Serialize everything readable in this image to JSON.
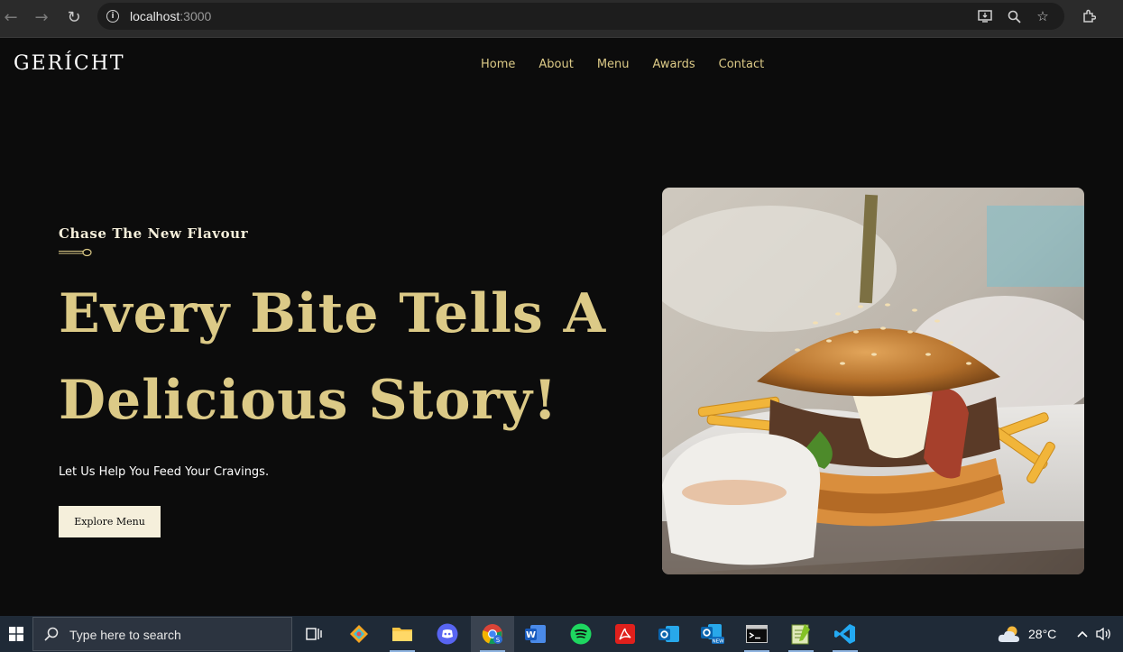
{
  "browser": {
    "url_host": "localhost",
    "url_port": ":3000"
  },
  "site": {
    "logo": "GERÍCHT",
    "nav": [
      "Home",
      "About",
      "Menu",
      "Awards",
      "Contact"
    ]
  },
  "hero": {
    "subtitle": "Chase The New Flavour",
    "title_line1": "Every Bite Tells A",
    "title_line2": "Delicious Story!",
    "text": "Let Us Help You Feed Your Cravings.",
    "button": "Explore Menu"
  },
  "taskbar": {
    "search_placeholder": "Type here to search",
    "temperature": "28°C"
  },
  "colors": {
    "background": "#0c0c0c",
    "gold": "#dcca87",
    "cream": "#f5efdb"
  }
}
